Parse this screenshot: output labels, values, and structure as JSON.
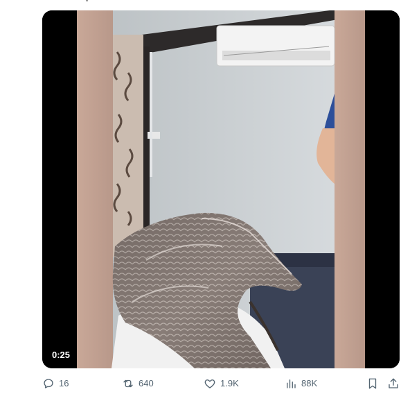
{
  "video": {
    "timestamp": "0:25"
  },
  "actions": {
    "reply": {
      "icon": "reply-icon",
      "count": "16"
    },
    "repost": {
      "icon": "repost-icon",
      "count": "640"
    },
    "like": {
      "icon": "heart-icon",
      "count": "1.9K"
    },
    "views": {
      "icon": "views-icon",
      "count": "88K"
    },
    "bookmark": {
      "icon": "bookmark-icon"
    },
    "share": {
      "icon": "share-icon"
    }
  },
  "colors": {
    "action_gray": "#536471",
    "media_background": "#000000"
  }
}
